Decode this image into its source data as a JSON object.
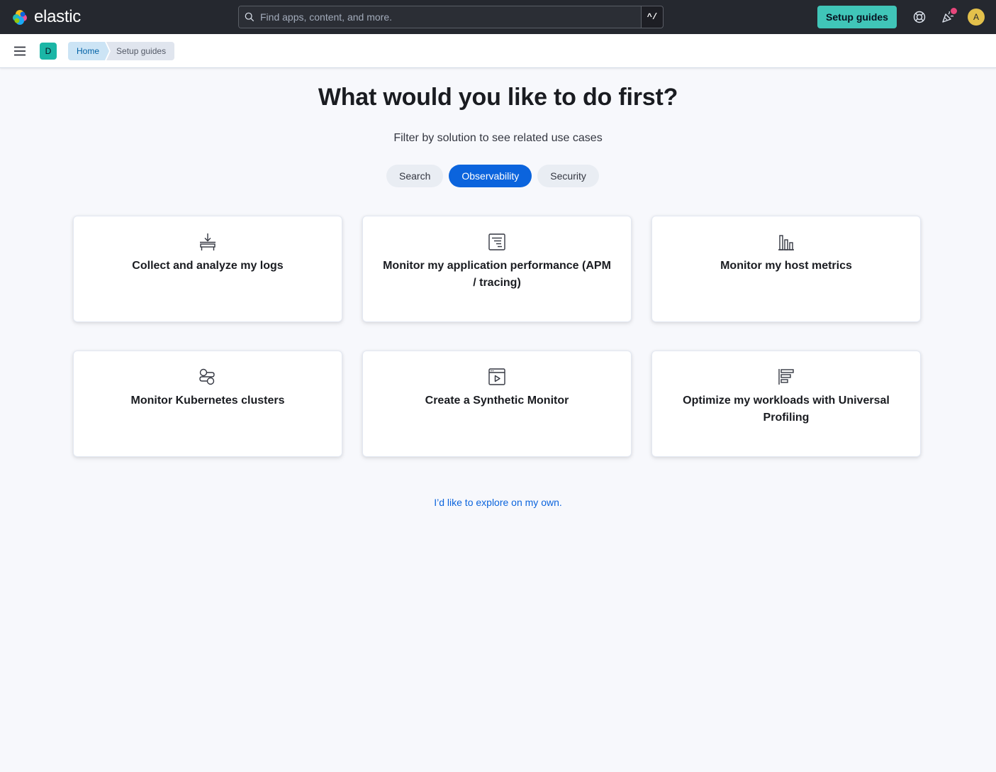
{
  "header": {
    "brand": "elastic",
    "search": {
      "placeholder": "Find apps, content, and more.",
      "shortcut": "^/"
    },
    "setup_guides_label": "Setup guides",
    "icons": [
      "help-icon",
      "newsfeed-icon"
    ],
    "avatar_initial": "A",
    "accent_color": "#40c5b8"
  },
  "subheader": {
    "space_initial": "D",
    "breadcrumbs": [
      "Home",
      "Setup guides"
    ]
  },
  "main": {
    "title": "What would you like to do first?",
    "subtitle": "Filter by solution to see related use cases",
    "filters": [
      {
        "label": "Search",
        "active": false
      },
      {
        "label": "Observability",
        "active": true
      },
      {
        "label": "Security",
        "active": false
      }
    ],
    "cards": [
      {
        "icon": "logs-icon",
        "title": "Collect and analyze my logs"
      },
      {
        "icon": "apm-icon",
        "title": "Monitor my application performance (APM / tracing)"
      },
      {
        "icon": "metrics-icon",
        "title": "Monitor my host metrics"
      },
      {
        "icon": "kubernetes-icon",
        "title": "Monitor Kubernetes clusters"
      },
      {
        "icon": "synthetics-icon",
        "title": "Create a Synthetic Monitor"
      },
      {
        "icon": "profiling-icon",
        "title": "Optimize my workloads with Universal Profiling"
      }
    ],
    "explore_link": "I’d like to explore on my own."
  }
}
